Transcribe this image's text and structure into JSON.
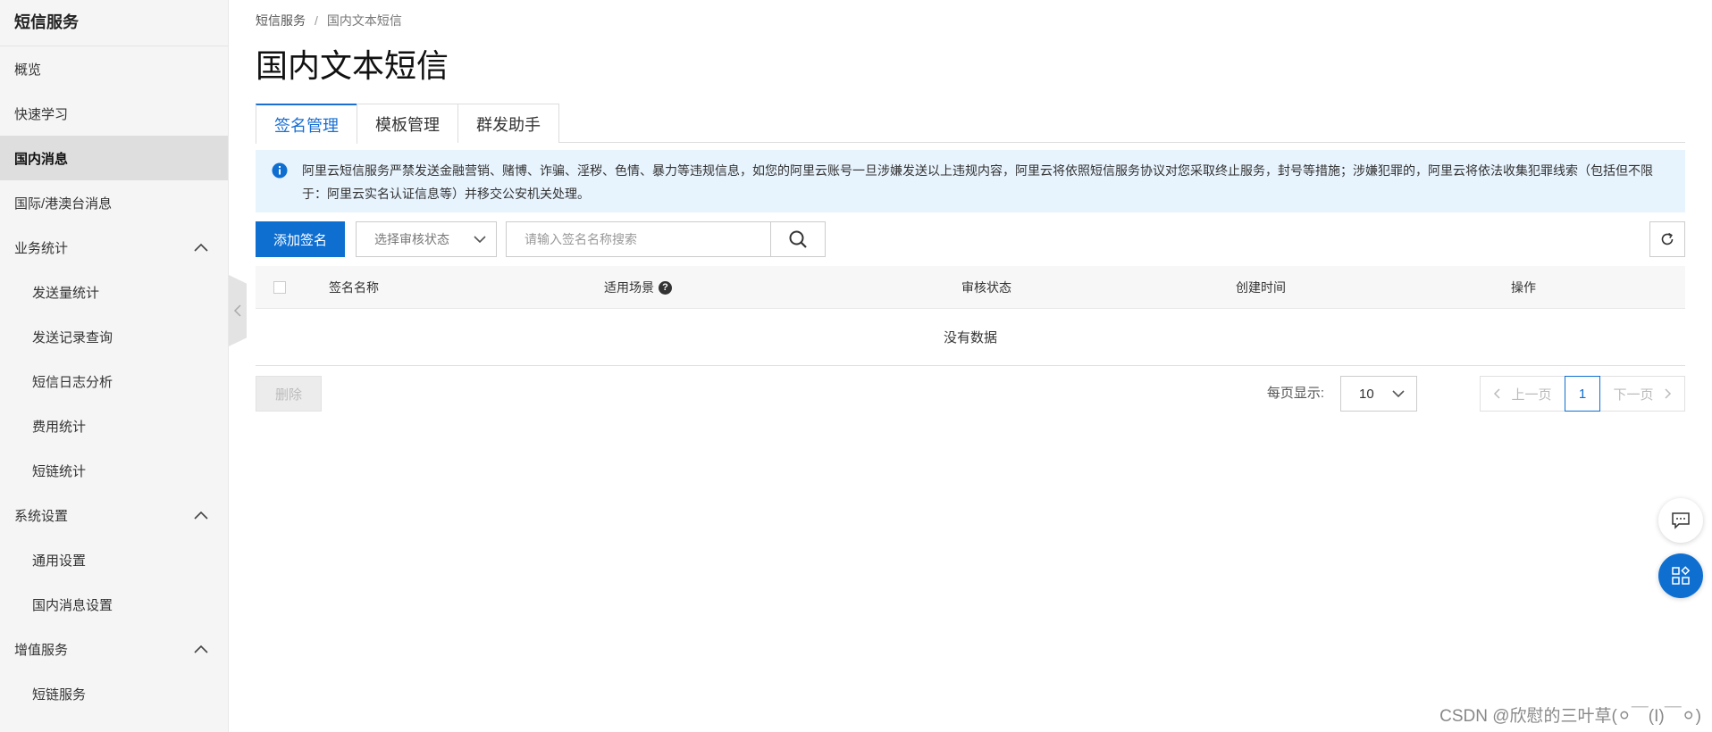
{
  "sidebar": {
    "title": "短信服务",
    "items": [
      {
        "label": "概览"
      },
      {
        "label": "快速学习"
      },
      {
        "label": "国内消息"
      },
      {
        "label": "国际/港澳台消息"
      },
      {
        "label": "业务统计"
      },
      {
        "label": "发送量统计"
      },
      {
        "label": "发送记录查询"
      },
      {
        "label": "短信日志分析"
      },
      {
        "label": "费用统计"
      },
      {
        "label": "短链统计"
      },
      {
        "label": "系统设置"
      },
      {
        "label": "通用设置"
      },
      {
        "label": "国内消息设置"
      },
      {
        "label": "增值服务"
      },
      {
        "label": "短链服务"
      }
    ]
  },
  "breadcrumb": {
    "root": "短信服务",
    "separator": "/",
    "current": "国内文本短信"
  },
  "page_title": "国内文本短信",
  "tabs": [
    {
      "label": "签名管理"
    },
    {
      "label": "模板管理"
    },
    {
      "label": "群发助手"
    }
  ],
  "notice": {
    "text": "阿里云短信服务严禁发送金融营销、赌博、诈骗、淫秽、色情、暴力等违规信息，如您的阿里云账号一旦涉嫌发送以上违规内容，阿里云将依照短信服务协议对您采取终止服务，封号等措施；涉嫌犯罪的，阿里云将依法收集犯罪线索（包括但不限于：阿里云实名认证信息等）并移交公安机关处理。"
  },
  "toolbar": {
    "add_label": "添加签名",
    "status_placeholder": "选择审核状态",
    "search_placeholder": "请输入签名名称搜索"
  },
  "table": {
    "columns": [
      "签名名称",
      "适用场景",
      "审核状态",
      "创建时间",
      "操作"
    ],
    "help_glyph": "?",
    "empty_text": "没有数据"
  },
  "footer": {
    "delete_label": "删除",
    "page_size_label": "每页显示:",
    "page_size": "10",
    "prev_label": "上一页",
    "current_page": "1",
    "next_label": "下一页"
  },
  "watermark": "CSDN @欣慰的三叶草(⚪￣(I)￣⚪)",
  "colors": {
    "primary": "#0e6fd1",
    "notice_bg": "#e7f3fd",
    "sidebar_bg": "#f5f5f5"
  }
}
